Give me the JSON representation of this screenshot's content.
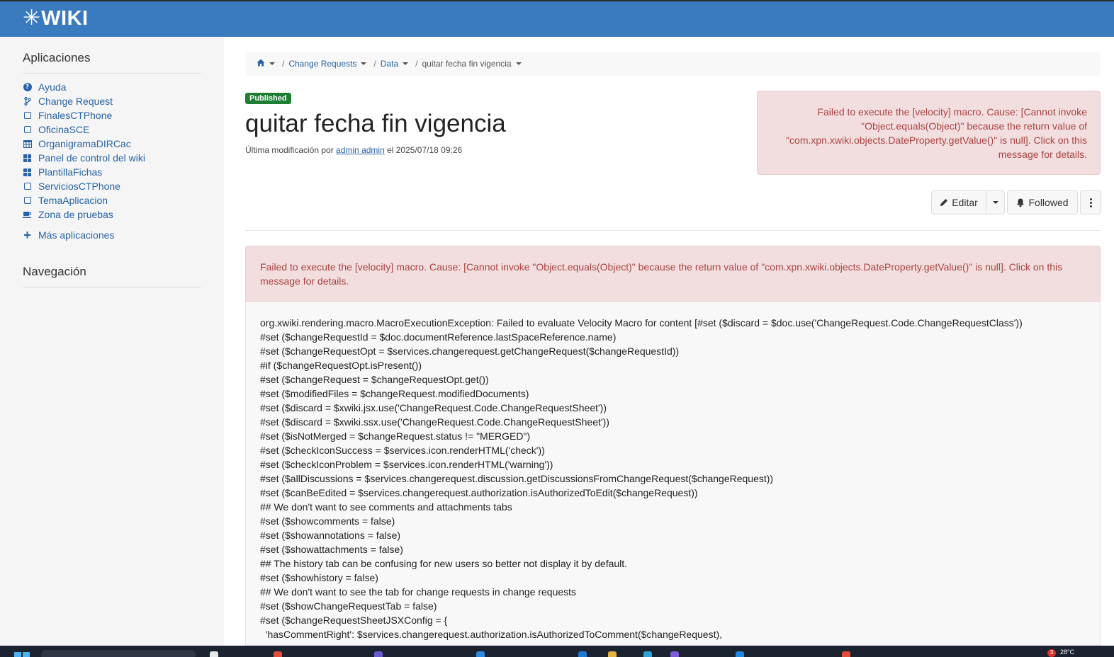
{
  "header": {
    "logo_text": "WIKI"
  },
  "sidebar": {
    "apps_title": "Aplicaciones",
    "apps": [
      {
        "label": "Ayuda",
        "icon": "question-circle-icon"
      },
      {
        "label": "Change Request",
        "icon": "branch-icon"
      },
      {
        "label": "FinalesCTPhone",
        "icon": "square-icon"
      },
      {
        "label": "OficinaSCE",
        "icon": "square-icon"
      },
      {
        "label": "OrganigramaDIRCac",
        "icon": "table-icon"
      },
      {
        "label": "Panel de control del wiki",
        "icon": "grid-icon"
      },
      {
        "label": "PlantillaFichas",
        "icon": "grid-icon"
      },
      {
        "label": "ServiciosCTPhone",
        "icon": "square-icon"
      },
      {
        "label": "TemaAplicacion",
        "icon": "square-icon"
      },
      {
        "label": "Zona de pruebas",
        "icon": "coffee-icon"
      }
    ],
    "more_apps": "Más aplicaciones",
    "nav_title": "Navegación"
  },
  "breadcrumb": {
    "items": [
      "Change Requests",
      "Data"
    ],
    "current": "quitar fecha fin vigencia"
  },
  "document": {
    "status_badge": "Published",
    "title": "quitar fecha fin vigencia",
    "meta_prefix": "Última modificación por ",
    "meta_author": "admin admin",
    "meta_suffix": " el 2025/07/18 09:26"
  },
  "alert_top": "Failed to execute the [velocity] macro. Cause: [Cannot invoke \"Object.equals(Object)\" because the return value of \"com.xpn.xwiki.objects.DateProperty.getValue()\" is null]. Click on this message for details.",
  "actions": {
    "edit_label": "Editar",
    "follow_label": "Followed"
  },
  "alert_main": "Failed to execute the [velocity] macro. Cause: [Cannot invoke \"Object.equals(Object)\" because the return value of \"com.xpn.xwiki.objects.DateProperty.getValue()\" is null]. Click on this message for details.",
  "code_lines": [
    "org.xwiki.rendering.macro.MacroExecutionException: Failed to evaluate Velocity Macro for content [#set ($discard = $doc.use('ChangeRequest.Code.ChangeRequestClass'))",
    "#set ($changeRequestId = $doc.documentReference.lastSpaceReference.name)",
    "#set ($changeRequestOpt = $services.changerequest.getChangeRequest($changeRequestId))",
    "#if ($changeRequestOpt.isPresent())",
    "#set ($changeRequest = $changeRequestOpt.get())",
    "#set ($modifiedFiles = $changeRequest.modifiedDocuments)",
    "#set ($discard = $xwiki.jsx.use('ChangeRequest.Code.ChangeRequestSheet'))",
    "#set ($discard = $xwiki.ssx.use('ChangeRequest.Code.ChangeRequestSheet'))",
    "#set ($isNotMerged = $changeRequest.status != \"MERGED\")",
    "#set ($checkIconSuccess = $services.icon.renderHTML('check'))",
    "#set ($checkIconProblem = $services.icon.renderHTML('warning'))",
    "#set ($allDiscussions = $services.changerequest.discussion.getDiscussionsFromChangeRequest($changeRequest))",
    "#set ($canBeEdited = $services.changerequest.authorization.isAuthorizedToEdit($changeRequest))",
    "## We don't want to see comments and attachments tabs",
    "#set ($showcomments = false)",
    "#set ($showannotations = false)",
    "#set ($showattachments = false)",
    "## The history tab can be confusing for new users so better not display it by default.",
    "#set ($showhistory = false)",
    "## We don't want to see the tab for change requests in change requests",
    "#set ($showChangeRequestTab = false)",
    "#set ($changeRequestSheetJSXConfig = {",
    "  'hasCommentRight': $services.changerequest.authorization.isAuthorizedToComment($changeRequest),"
  ],
  "taskbar": {
    "temperature": "28°C",
    "notification_count": "3"
  },
  "colors": {
    "header": "#3a7bbf",
    "link": "#2763a6",
    "alert_bg": "#f2dede",
    "alert_text": "#a94442",
    "badge": "#1e7e34"
  }
}
